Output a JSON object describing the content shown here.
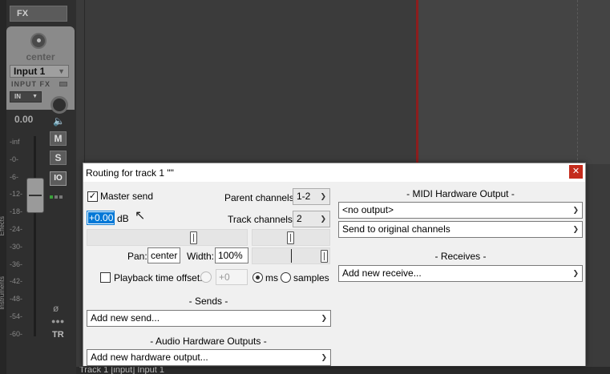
{
  "mixer": {
    "fx_label": "FX",
    "pan_value": "center",
    "input_label": "Input 1",
    "input_fx_label": "INPUT FX",
    "in_label": "IN",
    "volume": "0.00",
    "mute": "M",
    "solo": "S",
    "io": "IO",
    "scale": [
      "-inf",
      "-0-",
      "-6-",
      "-12-",
      "-18-",
      "-24-",
      "-30-",
      "-36-",
      "-42-",
      "-48-",
      "-54-",
      "-60-"
    ],
    "tr_label": "TR",
    "tabs": [
      "Effects",
      "Instruments"
    ]
  },
  "bottom_bar": {
    "text": "Track 1 [input] Input 1"
  },
  "colors": {
    "accent": "#0078d7",
    "close": "#c42b1c",
    "track_red": "#8c1d1d"
  },
  "dialog": {
    "title": "Routing for track 1 \"\"",
    "master_send": {
      "label": "Master send",
      "checked": true
    },
    "parent_channels": {
      "label": "Parent channels:",
      "value": "1-2"
    },
    "volume": {
      "value": "+0.00",
      "unit": "dB"
    },
    "track_channels": {
      "label": "Track channels:",
      "value": "2"
    },
    "volume_slider_level": 0.68,
    "pan_slider_level": 0.5,
    "width_slider_level": 1.0,
    "pan": {
      "label": "Pan:",
      "value": "center"
    },
    "width": {
      "label": "Width:",
      "value": "100%"
    },
    "playback_offset": {
      "label": "Playback time offset:",
      "value": "+0",
      "checked": false
    },
    "units": {
      "ms": "ms",
      "samples": "samples",
      "selected": "ms"
    },
    "sends": {
      "header": "- Sends -",
      "dropdown": "Add new send..."
    },
    "audio_hw": {
      "header": "- Audio Hardware Outputs -",
      "dropdown": "Add new hardware output..."
    },
    "midi_hw": {
      "header": "- MIDI Hardware Output -",
      "output": "<no output>",
      "channels": "Send to original channels"
    },
    "receives": {
      "header": "- Receives -",
      "dropdown": "Add new receive..."
    }
  }
}
